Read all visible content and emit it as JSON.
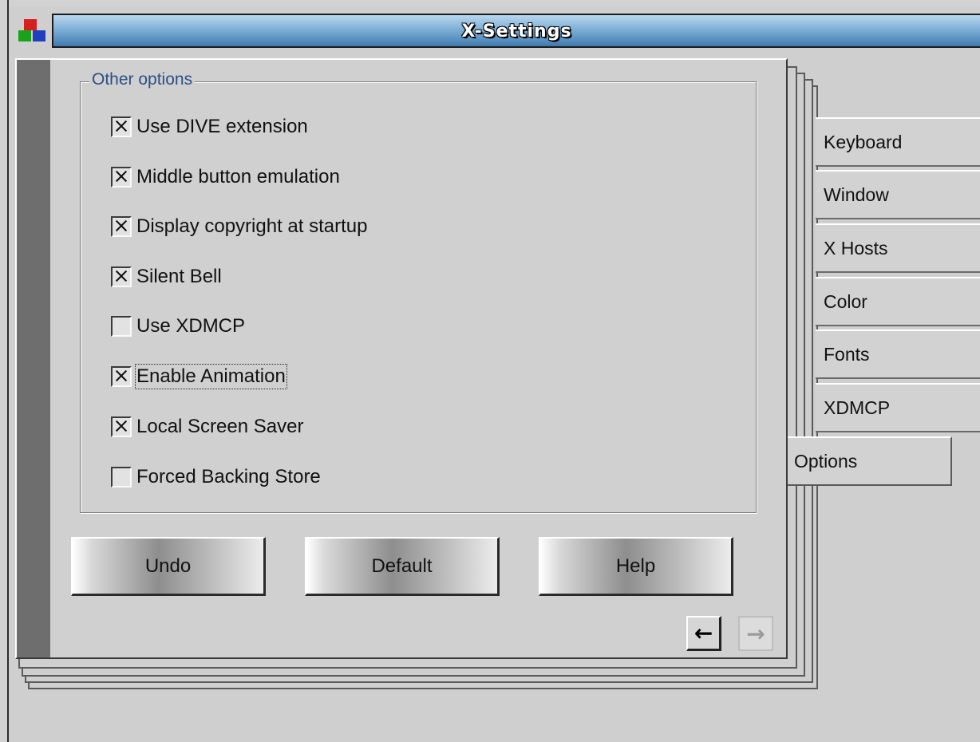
{
  "window": {
    "title": "X-Settings"
  },
  "notebook": {
    "group_title": "Other options",
    "options": [
      {
        "label": "Use DIVE extension",
        "checked": true
      },
      {
        "label": "Middle button emulation",
        "checked": true
      },
      {
        "label": "Display copyright at startup",
        "checked": true
      },
      {
        "label": "Silent Bell",
        "checked": true
      },
      {
        "label": "Use XDMCP",
        "checked": false
      },
      {
        "label": "Enable Animation",
        "checked": true,
        "focused": true
      },
      {
        "label": "Local Screen Saver",
        "checked": true
      },
      {
        "label": "Forced Backing Store",
        "checked": false
      }
    ],
    "buttons": {
      "undo": "Undo",
      "default": "Default",
      "help": "Help"
    },
    "nav": {
      "prev": "←",
      "next": "→"
    }
  },
  "tabs": [
    {
      "label": "Keyboard"
    },
    {
      "label": "Window"
    },
    {
      "label": "X Hosts"
    },
    {
      "label": "Color"
    },
    {
      "label": "Fonts"
    },
    {
      "label": "XDMCP"
    }
  ],
  "active_tab": "Options",
  "colors": {
    "titlebar": "#3f7bb0",
    "group_title": "#2b4f86",
    "background": "#cfcfcf"
  }
}
